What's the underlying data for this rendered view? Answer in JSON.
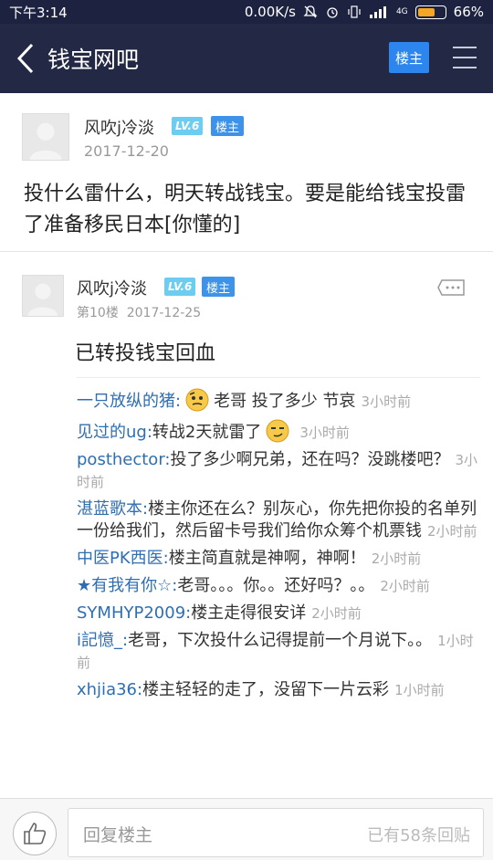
{
  "status_bar": {
    "time": "下午3:14",
    "speed": "0.00K/s",
    "network": "4G",
    "battery": "66%",
    "battery_level": 0.66
  },
  "nav": {
    "title": "钱宝网吧",
    "owner_button": "楼主"
  },
  "post": {
    "username": "风吹j冷淡",
    "level": "LV.6",
    "owner_tag": "楼主",
    "date": "2017-12-20",
    "content": "投什么雷什么，明天转战钱宝。要是能给钱宝投雷了准备移民日本[你懂的]"
  },
  "floor": {
    "username": "风吹j冷淡",
    "level": "LV.6",
    "owner_tag": "楼主",
    "floor_label": "第10楼",
    "date": "2017-12-25",
    "content": "已转投钱宝回血",
    "replies": [
      {
        "author": "一只放纵的猪:",
        "emoji": "thinking",
        "text": "老哥 投了多少 节哀",
        "time": "3小时前"
      },
      {
        "author": "见过的ug:",
        "text": "转战2天就雷了",
        "emoji_after": "smirk",
        "time": "3小时前"
      },
      {
        "author": "posthector:",
        "text": "投了多少啊兄弟，还在吗？没跳楼吧？",
        "time": "3小时前"
      },
      {
        "author": "湛蓝歌本:",
        "text": "楼主你还在么？别灰心，你先把你投的名单列一份给我们，然后留卡号我们给你众筹个机票钱",
        "time": "2小时前"
      },
      {
        "author": "中医PK西医:",
        "text": "楼主简直就是神啊，神啊！",
        "time": "2小时前"
      },
      {
        "author": "★有我有你☆:",
        "text": "老哥。。。你。。还好吗？。。",
        "time": "2小时前"
      },
      {
        "author": "SYMHYP2009:",
        "text": "楼主走得很安详",
        "time": "2小时前"
      },
      {
        "author": "i記憶_:",
        "text": "老哥，下次投什么记得提前一个月说下。。",
        "time": "1小时前"
      },
      {
        "author": "xhjia36:",
        "text": "楼主轻轻的走了，没留下一片云彩",
        "time": "1小时前"
      }
    ]
  },
  "bottom_bar": {
    "placeholder": "回复楼主",
    "reply_count": "已有58条回贴"
  }
}
